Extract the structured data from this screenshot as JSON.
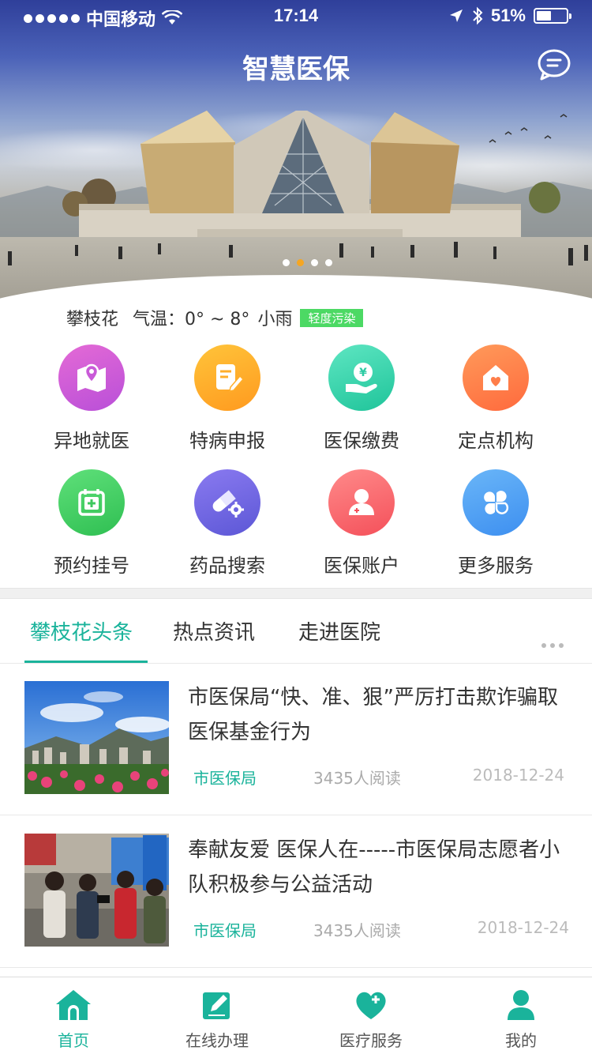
{
  "status_bar": {
    "carrier": "中国移动",
    "time": "17:14",
    "battery": "51%",
    "battery_level": 0.51
  },
  "header": {
    "title": "智慧医保",
    "message_icon": "message-icon"
  },
  "carousel": {
    "slide_count": 4,
    "active_index": 1
  },
  "weather": {
    "city": "攀枝花",
    "temperature": "气温：0° ~ 8°",
    "condition": "小雨",
    "air_quality": "轻度污染"
  },
  "services": [
    {
      "label": "异地就医",
      "icon": "map-pin-icon",
      "color_from": "#e46ad6",
      "color_to": "#b94fd8"
    },
    {
      "label": "特病申报",
      "icon": "document-edit-icon",
      "color_from": "#ffc43a",
      "color_to": "#ff9a1f"
    },
    {
      "label": "医保缴费",
      "icon": "yuan-coin-hand-icon",
      "color_from": "#5ee6c2",
      "color_to": "#1fc49a"
    },
    {
      "label": "定点机构",
      "icon": "house-heart-icon",
      "color_from": "#ff9a5a",
      "color_to": "#ff6a3d"
    },
    {
      "label": "预约挂号",
      "icon": "calendar-medical-icon",
      "color_from": "#5fe07a",
      "color_to": "#2fbf52"
    },
    {
      "label": "药品搜索",
      "icon": "pill-gear-icon",
      "color_from": "#8a7af0",
      "color_to": "#5c57d6"
    },
    {
      "label": "医保账户",
      "icon": "doctor-user-icon",
      "color_from": "#ff8a8a",
      "color_to": "#f4505a"
    },
    {
      "label": "更多服务",
      "icon": "grid-more-icon",
      "color_from": "#6ab6f8",
      "color_to": "#3d8ff0"
    }
  ],
  "news_tabs": [
    {
      "label": "攀枝花头条",
      "active": true
    },
    {
      "label": "热点资讯",
      "active": false
    },
    {
      "label": "走进医院",
      "active": false
    }
  ],
  "news": [
    {
      "title": "市医保局“快、准、狠”严厉打击欺诈骗取医保基金行为",
      "source": "市医保局",
      "reads": "3435人阅读",
      "date": "2018-12-24"
    },
    {
      "title": "奉献友爱 医保人在-----市医保局志愿者小队积极参与公益活动",
      "source": "市医保局",
      "reads": "3435人阅读",
      "date": "2018-12-24"
    }
  ],
  "tabbar": [
    {
      "label": "首页",
      "icon": "home-icon",
      "active": true
    },
    {
      "label": "在线办理",
      "icon": "edit-pen-icon",
      "active": false
    },
    {
      "label": "医疗服务",
      "icon": "heart-plus-icon",
      "active": false
    },
    {
      "label": "我的",
      "icon": "user-icon",
      "active": false
    }
  ],
  "colors": {
    "accent": "#1ab39b",
    "carousel_active": "#f5a623",
    "air_tag": "#4cd964"
  }
}
